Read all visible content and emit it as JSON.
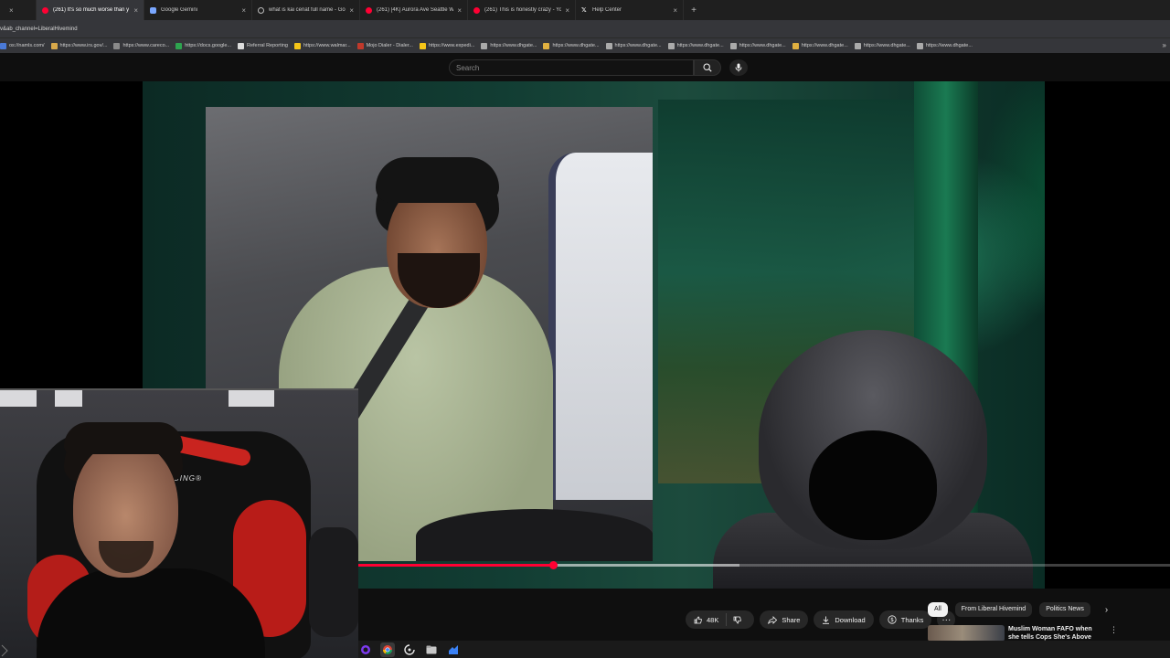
{
  "browser": {
    "tabs": [
      {
        "title": "",
        "favicon": "youtube-icon"
      },
      {
        "title": "(261) It's so much worse than y",
        "favicon": "youtube-icon",
        "active": true
      },
      {
        "title": "Google Gemini",
        "favicon": "gemini-icon"
      },
      {
        "title": "what is kai cenat full name - Go",
        "favicon": "globe-icon"
      },
      {
        "title": "(261) [4K] Aurora Ave Seattle W",
        "favicon": "youtube-icon"
      },
      {
        "title": "(261) This is honestly crazy - Yo",
        "favicon": "youtube-icon"
      },
      {
        "title": "Help Center",
        "favicon": "x-icon"
      }
    ],
    "new_tab": "+",
    "url": "v&ab_channel=LiberalHivemind",
    "bookmarks": [
      {
        "label": "os://namls.com/",
        "color": "#4a7ad8"
      },
      {
        "label": "https://www.irs.gov/...",
        "color": "#d8a84a"
      },
      {
        "label": "https://www.careco...",
        "color": "#8a8a8a"
      },
      {
        "label": "https://docs.google...",
        "color": "#2ea44f"
      },
      {
        "label": "Referral Reporting",
        "color": "#dddddd"
      },
      {
        "label": "https://www.walmar...",
        "color": "#f5c518"
      },
      {
        "label": "Mojo Dialer - Dialer...",
        "color": "#c0392b"
      },
      {
        "label": "https://www.expedi...",
        "color": "#f5c518"
      },
      {
        "label": "https://www.dhgate...",
        "color": "#aaaaaa"
      },
      {
        "label": "https://www.dhgate...",
        "color": "#e0b040"
      },
      {
        "label": "https://www.dhgate...",
        "color": "#aaaaaa"
      },
      {
        "label": "https://www.dhgate...",
        "color": "#aaaaaa"
      },
      {
        "label": "https://www.dhgate...",
        "color": "#aaaaaa"
      },
      {
        "label": "https://www.dhgate...",
        "color": "#e0b040"
      },
      {
        "label": "https://www.dhgate...",
        "color": "#aaaaaa"
      },
      {
        "label": "https://www.dhgate...",
        "color": "#aaaaaa"
      }
    ],
    "bookmarks_more": "»"
  },
  "youtube": {
    "search_placeholder": "Search",
    "webcam_chair_logo": "CING®",
    "progress_played": 0.24,
    "progress_buffered": 0.47,
    "actions": {
      "likes": "48K",
      "share": "Share",
      "download": "Download",
      "thanks": "Thanks",
      "more": "···"
    },
    "chips": [
      {
        "label": "All",
        "selected": true
      },
      {
        "label": "From Liberal Hivemind",
        "selected": false
      },
      {
        "label": "Politics News",
        "selected": false
      }
    ],
    "chips_next": "›",
    "recommendation": {
      "title": "Muslim Woman FAFO when she tells Cops She's Above",
      "menu": "⋮"
    }
  },
  "colors": {
    "youtube_red": "#ff0033",
    "chrome_dark": "#1f1f1f",
    "chrome_toolbar": "#35363a",
    "yt_bg": "#0f0f0f"
  }
}
